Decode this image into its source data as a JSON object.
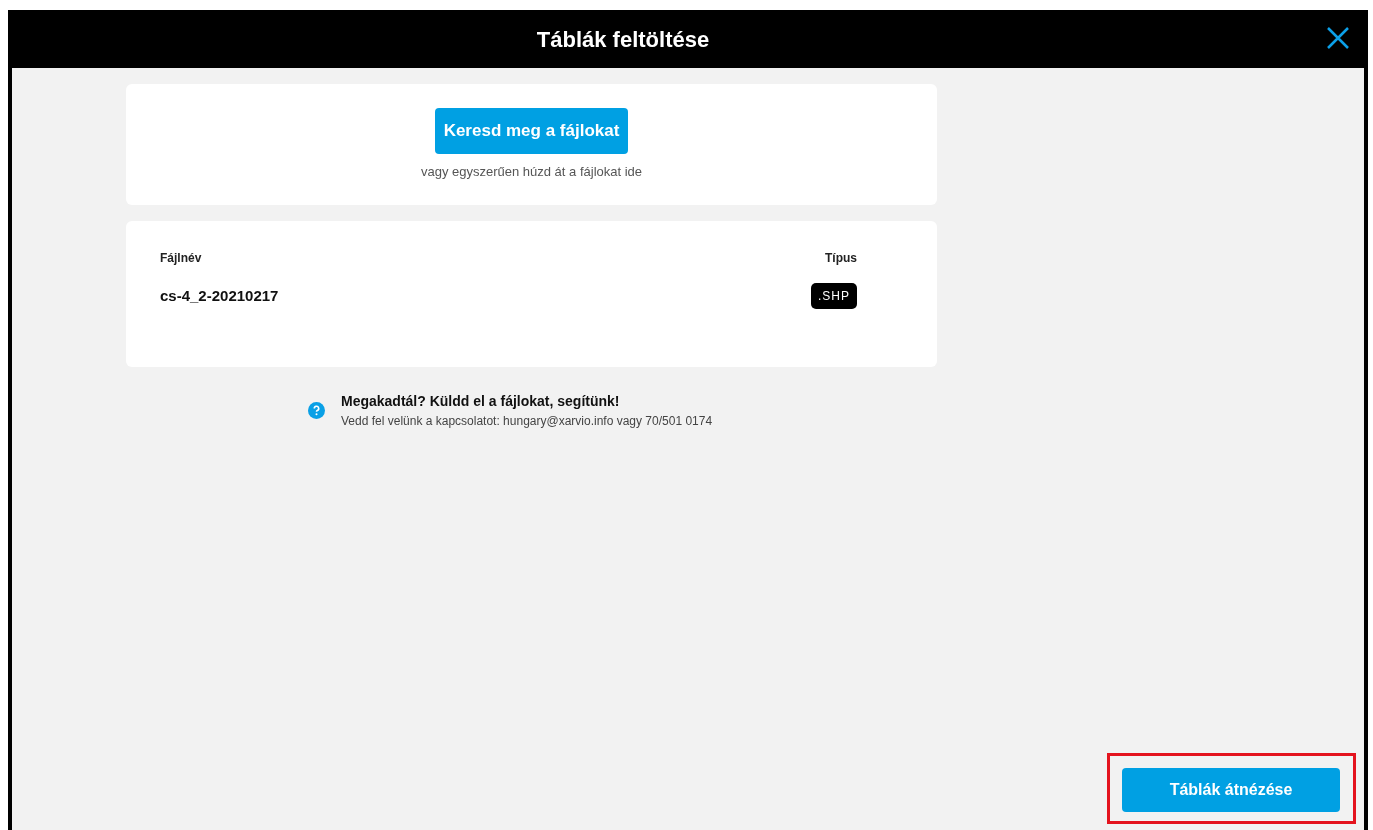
{
  "window": {
    "title": "Táblák feltöltése"
  },
  "upload": {
    "button": "Keresd meg a fájlokat",
    "hint": "vagy egyszerűen húzd át a fájlokat ide"
  },
  "files": {
    "columns": [
      "Fájlnév",
      "Típus"
    ],
    "rows": [
      {
        "name": "cs-4_2-20210217",
        "type": ".SHP"
      }
    ]
  },
  "help": {
    "title": "Megakadtál? Küldd el a fájlokat, segítünk!",
    "text": "Vedd fel velünk a kapcsolatot: hungary@xarvio.info vagy 70/501 0174"
  },
  "footer": {
    "button": "Táblák átnézése",
    "highlighted": true
  }
}
